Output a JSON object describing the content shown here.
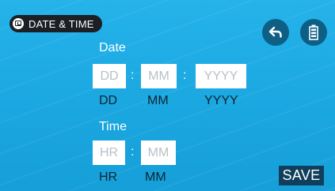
{
  "header": {
    "title": "DATE & TIME",
    "title_icon": "calendar-clock-icon"
  },
  "toolbar": {
    "back_icon": "back-arrow-icon",
    "battery_icon": "battery-icon"
  },
  "date": {
    "label": "Date",
    "day": {
      "placeholder": "DD",
      "caption": "DD"
    },
    "month": {
      "placeholder": "MM",
      "caption": "MM"
    },
    "year": {
      "placeholder": "YYYY",
      "caption": "YYYY"
    },
    "separator": ":"
  },
  "time": {
    "label": "Time",
    "hour": {
      "placeholder": "HR",
      "caption": "HR"
    },
    "minute": {
      "placeholder": "MM",
      "caption": "MM"
    },
    "separator": ":"
  },
  "actions": {
    "save_label": "SAVE"
  },
  "colors": {
    "background": "#1aa6df",
    "button_dark": "#0d5f86",
    "save_bg": "#0f3f5c"
  }
}
